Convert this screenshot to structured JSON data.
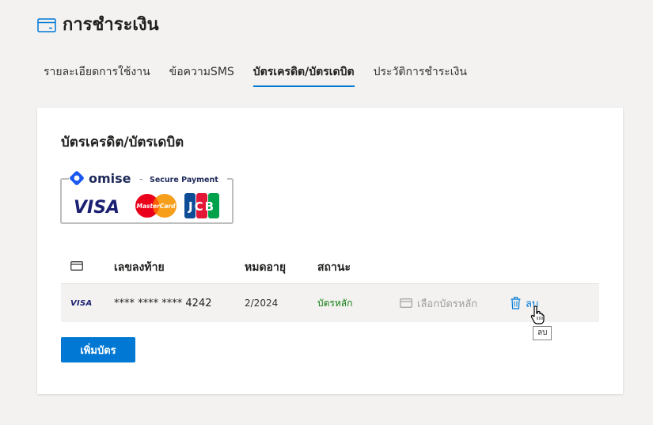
{
  "header": {
    "title": "การชำระเงิน",
    "icon": "card-icon"
  },
  "tabs": [
    {
      "label": "รายละเอียดการใช้งาน",
      "active": false
    },
    {
      "label": "ข้อความSMS",
      "active": false
    },
    {
      "label": "บัตรเครดิต/บัตรเดบิต",
      "active": true
    },
    {
      "label": "ประวัติการชำระเงิน",
      "active": false
    }
  ],
  "section": {
    "title": "บัตรเครดิต/บัตรเดบิต",
    "badge": {
      "brand": "omise",
      "tagline": "Secure Payment",
      "visa": "VISA",
      "mastercard": "MasterCard",
      "jcb": "JCB"
    }
  },
  "table": {
    "headers": {
      "last_digits": "เลขลงท้าย",
      "expiry": "หมดอายุ",
      "status": "สถานะ"
    },
    "rows": [
      {
        "brand": "VISA",
        "number": "**** **** **** 4242",
        "expiry": "2/2024",
        "status": "บัตรหลัก",
        "set_primary_label": "เลือกบัตรหลัก",
        "delete_label": "ลบ"
      }
    ]
  },
  "add_button_label": "เพิ่มบัตร",
  "tooltip": "ลบ",
  "colors": {
    "accent": "#0078d4",
    "status_primary": "#107c10",
    "disabled": "#a19f9d",
    "background": "#f3f2f1"
  }
}
